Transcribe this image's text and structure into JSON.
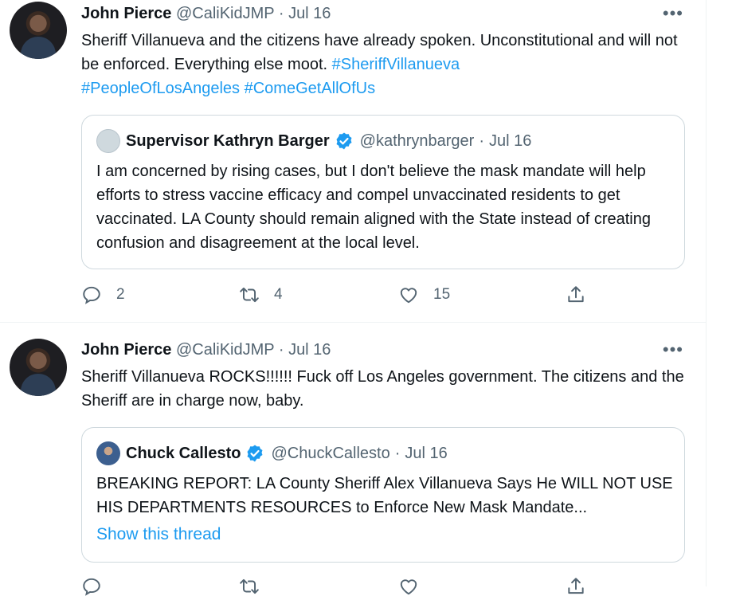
{
  "tweets": [
    {
      "name": "John Pierce",
      "handle": "@CaliKidJMP",
      "dot": "·",
      "date": "Jul 16",
      "more": "•••",
      "text_plain": "Sheriff Villanueva and the citizens have already spoken. Unconstitutional and will not be enforced. Everything else moot. ",
      "hashtags": [
        "#SheriffVillanueva",
        "#PeopleOfLosAngeles",
        "#ComeGetAllOfUs"
      ],
      "quote": {
        "name": "Supervisor Kathryn Barger",
        "handle": "@kathrynbarger",
        "dot": "·",
        "date": "Jul 16",
        "text": "I am concerned by rising cases, but I don't believe the mask mandate will help efforts to stress vaccine efficacy and compel unvaccinated residents to get vaccinated. LA County should remain aligned with the State instead of creating confusion and disagreement at the local level."
      },
      "actions": {
        "replies": "2",
        "retweets": "4",
        "likes": "15"
      }
    },
    {
      "name": "John Pierce",
      "handle": "@CaliKidJMP",
      "dot": "·",
      "date": "Jul 16",
      "more": "•••",
      "text": "Sheriff Villanueva ROCKS!!!!!! Fuck off Los Angeles government. The citizens and the Sheriff are in charge now, baby.",
      "quote": {
        "name": "Chuck Callesto",
        "handle": "@ChuckCallesto",
        "dot": "·",
        "date": "Jul 16",
        "text": "BREAKING REPORT: LA County Sheriff Alex Villanueva Says He WILL NOT USE HIS DEPARTMENTS RESOURCES to Enforce New Mask Mandate...",
        "thread_link": "Show this thread"
      }
    }
  ],
  "icons": {
    "reply": "reply-icon",
    "retweet": "retweet-icon",
    "like": "like-icon",
    "share": "share-icon",
    "verified": "verified-badge-icon"
  },
  "colors": {
    "link": "#1d9bf0",
    "muted": "#536471",
    "text": "#0f1419",
    "border": "#cfd9de"
  }
}
